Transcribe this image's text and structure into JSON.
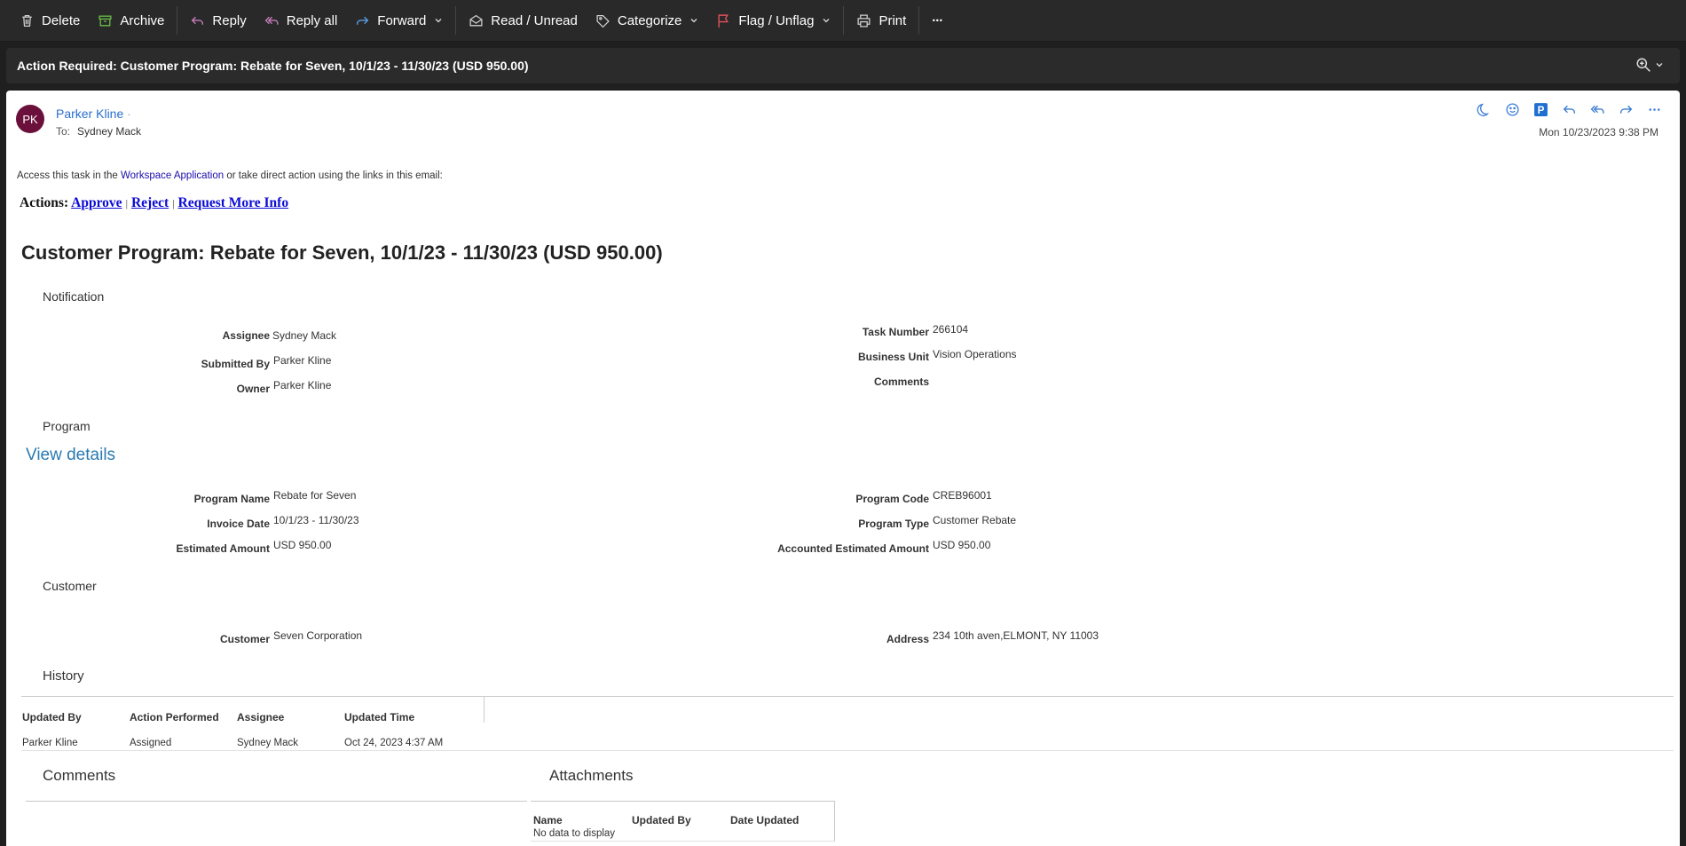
{
  "toolbar": {
    "delete": "Delete",
    "archive": "Archive",
    "reply": "Reply",
    "reply_all": "Reply all",
    "forward": "Forward",
    "read_unread": "Read / Unread",
    "categorize": "Categorize",
    "flag": "Flag / Unflag",
    "print": "Print",
    "more": "···"
  },
  "subject": "Action Required: Customer Program: Rebate for Seven, 10/1/23 - 11/30/23 (USD 950.00)",
  "header": {
    "avatar_initials": "PK",
    "sender": "Parker Kline",
    "to_label": "To:",
    "to": "Sydney Mack",
    "date": "Mon 10/23/2023 9:38 PM"
  },
  "body": {
    "access_prefix": "Access this task in the",
    "access_link": "Workspace Application",
    "access_suffix": "or take direct action using the links in this email:",
    "actions_label": "Actions:",
    "approve": "Approve",
    "reject": "Reject",
    "request_info": "Request More Info",
    "title": "Customer Program: Rebate for Seven, 10/1/23 - 11/30/23 (USD 950.00)",
    "notification": {
      "heading": "Notification",
      "assignee_label": "Assignee",
      "assignee": "Sydney Mack",
      "submitted_label": "Submitted By",
      "submitted": "Parker Kline",
      "owner_label": "Owner",
      "owner": "Parker Kline",
      "task_label": "Task Number",
      "task": "266104",
      "bu_label": "Business Unit",
      "bu": "Vision Operations",
      "comments_label": "Comments"
    },
    "program": {
      "heading": "Program",
      "view_details": "View details",
      "name_label": "Program Name",
      "name": "Rebate for Seven",
      "invoice_label": "Invoice Date",
      "invoice": "10/1/23 - 11/30/23",
      "est_label": "Estimated Amount",
      "est": "USD 950.00",
      "code_label": "Program Code",
      "code": "CREB96001",
      "type_label": "Program Type",
      "type": "Customer Rebate",
      "acc_label": "Accounted Estimated Amount",
      "acc": "USD 950.00"
    },
    "customer": {
      "heading": "Customer",
      "customer_label": "Customer",
      "customer": "Seven Corporation",
      "address_label": "Address",
      "address": "234 10th aven,ELMONT, NY 11003"
    },
    "history": {
      "heading": "History",
      "columns": [
        "Updated By",
        "Action Performed",
        "Assignee",
        "Updated Time"
      ],
      "rows": [
        [
          "Parker Kline",
          "Assigned",
          "Sydney Mack",
          "Oct 24, 2023 4:37 AM"
        ]
      ]
    },
    "comments_heading": "Comments",
    "attachments": {
      "heading": "Attachments",
      "columns": [
        "Name",
        "Updated By",
        "Date Updated"
      ],
      "empty": "No data to display"
    }
  }
}
